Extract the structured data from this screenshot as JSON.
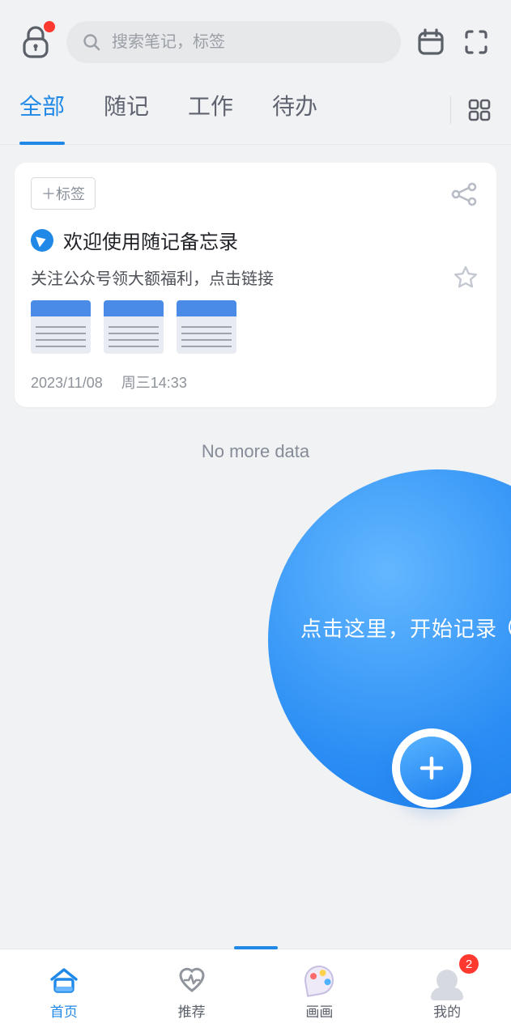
{
  "search": {
    "placeholder": "搜索笔记，标签"
  },
  "tabs": [
    {
      "label": "全部",
      "active": true
    },
    {
      "label": "随记",
      "active": false
    },
    {
      "label": "工作",
      "active": false
    },
    {
      "label": "待办",
      "active": false
    }
  ],
  "card": {
    "tag_add_label": "＋标签",
    "title": "欢迎使用随记备忘录",
    "desc": "关注公众号领大额福利，点击链接",
    "date": "2023/11/08",
    "weektime": "周三14:33"
  },
  "list": {
    "no_more": "No more data"
  },
  "cta": {
    "text": "点击这里，开始记录"
  },
  "nav": {
    "items": [
      {
        "label": "首页",
        "icon": "home",
        "active": true
      },
      {
        "label": "推荐",
        "icon": "heart",
        "active": false
      },
      {
        "label": "画画",
        "icon": "palette",
        "active": false
      },
      {
        "label": "我的",
        "icon": "avatar",
        "active": false,
        "badge": "2"
      }
    ]
  }
}
